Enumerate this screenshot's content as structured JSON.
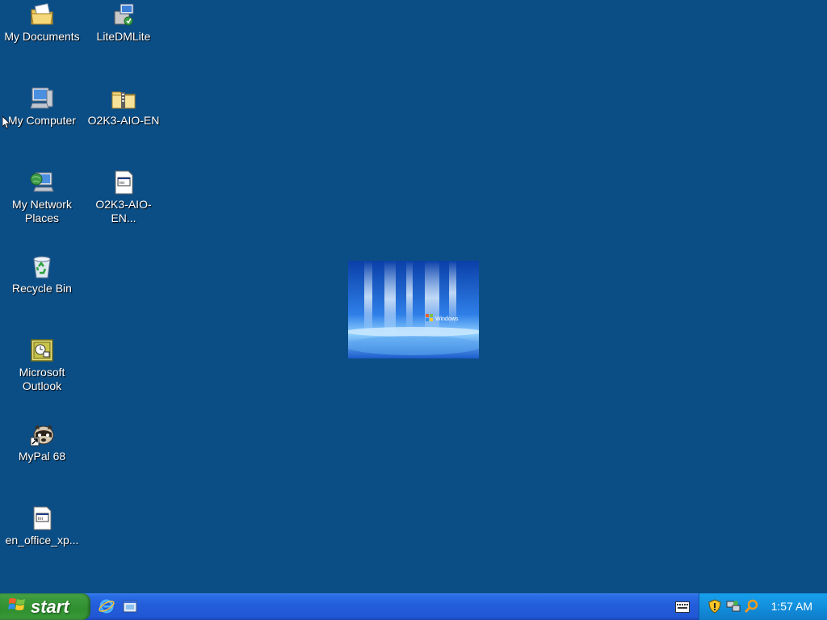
{
  "desktop": {
    "icons": [
      {
        "label": "My Documents",
        "icon": "my-documents-icon"
      },
      {
        "label": "LiteDMLite",
        "icon": "installer-icon"
      },
      {
        "label": "My Computer",
        "icon": "my-computer-icon"
      },
      {
        "label": "O2K3-AIO-EN",
        "icon": "zip-folder-icon"
      },
      {
        "label": "My Network Places",
        "icon": "network-places-icon"
      },
      {
        "label": "O2K3-AIO-EN...",
        "icon": "ini-file-icon"
      },
      {
        "label": "Recycle Bin",
        "icon": "recycle-bin-icon"
      },
      {
        "label": "Microsoft Outlook",
        "icon": "outlook-icon"
      },
      {
        "label": "MyPal 68",
        "icon": "mypal-icon"
      },
      {
        "label": "en_office_xp...",
        "icon": "ini-file-icon"
      }
    ],
    "wallpaper": {
      "brand_text": "Windows"
    }
  },
  "taskbar": {
    "start_label": "start",
    "quick_launch": [
      "internet-explorer-icon",
      "show-desktop-icon"
    ],
    "tray_icons": [
      "language-keyboard-icon",
      "security-shield-icon",
      "network-icon",
      "search-icon"
    ],
    "clock": "1:57 AM"
  },
  "colors": {
    "desktop_bg": "#0b4e86",
    "taskbar_blue": "#245edb",
    "start_green": "#3c9a3c",
    "tray_blue": "#128fdc"
  }
}
